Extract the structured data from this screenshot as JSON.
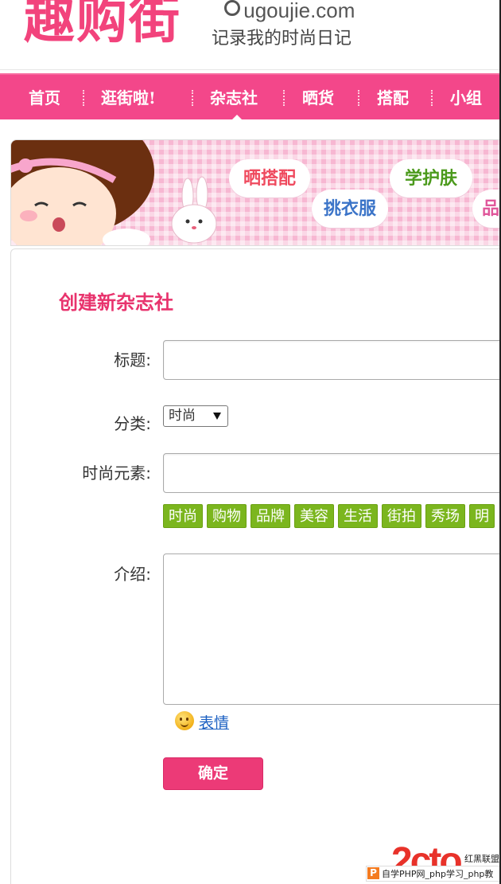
{
  "header": {
    "logo_text": "趣购街",
    "site_url": "ugoujie.com",
    "slogan": "记录我的时尚日记"
  },
  "nav": {
    "items": [
      "首页",
      "逛街啦!",
      "杂志社",
      "晒货",
      "搭配",
      "小组"
    ],
    "active_index": 2
  },
  "banner": {
    "bubbles": [
      "晒搭配",
      "挑衣服",
      "学护肤",
      "品"
    ]
  },
  "form": {
    "title": "创建新杂志社",
    "title_label": "标题:",
    "title_value": "",
    "category_label": "分类:",
    "category_selected": "时尚",
    "elements_label": "时尚元素:",
    "elements_value": "",
    "tags": [
      "时尚",
      "购物",
      "品牌",
      "美容",
      "生活",
      "街拍",
      "秀场",
      "明"
    ],
    "intro_label": "介绍:",
    "intro_value": "",
    "emoji_label": "表情",
    "submit_label": "确定"
  },
  "watermark": {
    "logo": "2cto",
    "org": "红黑联盟",
    "badge": "P",
    "caption": "自学PHP网_php学习_php教"
  },
  "colors": {
    "brand_pink": "#f3478a",
    "title_pink": "#e8336d",
    "tag_green": "#7bb61e",
    "link_blue": "#1a5fc2"
  }
}
